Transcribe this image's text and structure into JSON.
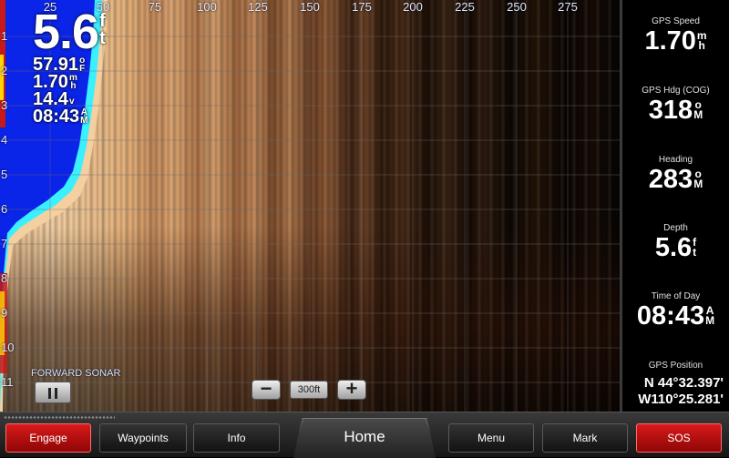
{
  "sonar": {
    "x_ticks": [
      "25",
      "50",
      "75",
      "100",
      "125",
      "150",
      "175",
      "200",
      "225",
      "250",
      "275"
    ],
    "y_ticks": [
      "1",
      "2",
      "3",
      "4",
      "5",
      "6",
      "7",
      "8",
      "9",
      "10",
      "11"
    ],
    "readout": {
      "depth": "5.6",
      "depth_unit_top": "f",
      "depth_unit_bottom": "t",
      "water_temp": "57.91",
      "water_temp_unit_top": "o",
      "water_temp_unit_bottom": "F",
      "speed": "1.70",
      "speed_unit_top": "m",
      "speed_unit_bottom": "h",
      "voltage": "14.4",
      "voltage_unit": "v",
      "time": "08:43",
      "time_unit_top": "A",
      "time_unit_bottom": "M"
    },
    "mode_label": "FORWARD SONAR",
    "zoom_minus": "−",
    "zoom_range": "300ft",
    "zoom_plus": "+"
  },
  "sidebar": {
    "gps_speed": {
      "label": "GPS Speed",
      "value": "1.70",
      "unit_top": "m",
      "unit_bottom": "h"
    },
    "gps_hdg": {
      "label": "GPS Hdg (COG)",
      "value": "318",
      "unit_top": "o",
      "unit_bottom": "M"
    },
    "heading": {
      "label": "Heading",
      "value": "283",
      "unit_top": "o",
      "unit_bottom": "M"
    },
    "depth": {
      "label": "Depth",
      "value": "5.6",
      "unit_top": "f",
      "unit_bottom": "t"
    },
    "time_of_day": {
      "label": "Time of Day",
      "value": "08:43",
      "unit_top": "A",
      "unit_bottom": "M"
    },
    "gps_position": {
      "label": "GPS Position",
      "lat": "N  44°32.397'",
      "lon": "W110°25.281'"
    }
  },
  "bottombar": {
    "engage": "Engage",
    "waypoints": "Waypoints",
    "info": "Info",
    "home": "Home",
    "menu": "Menu",
    "mark": "Mark",
    "sos": "SOS"
  },
  "colors": {
    "engage_red": "#c70f0f",
    "sos_red": "#c70f0f",
    "water_blue": "#0a24e8",
    "bottom_return": "#f4cfa0"
  }
}
